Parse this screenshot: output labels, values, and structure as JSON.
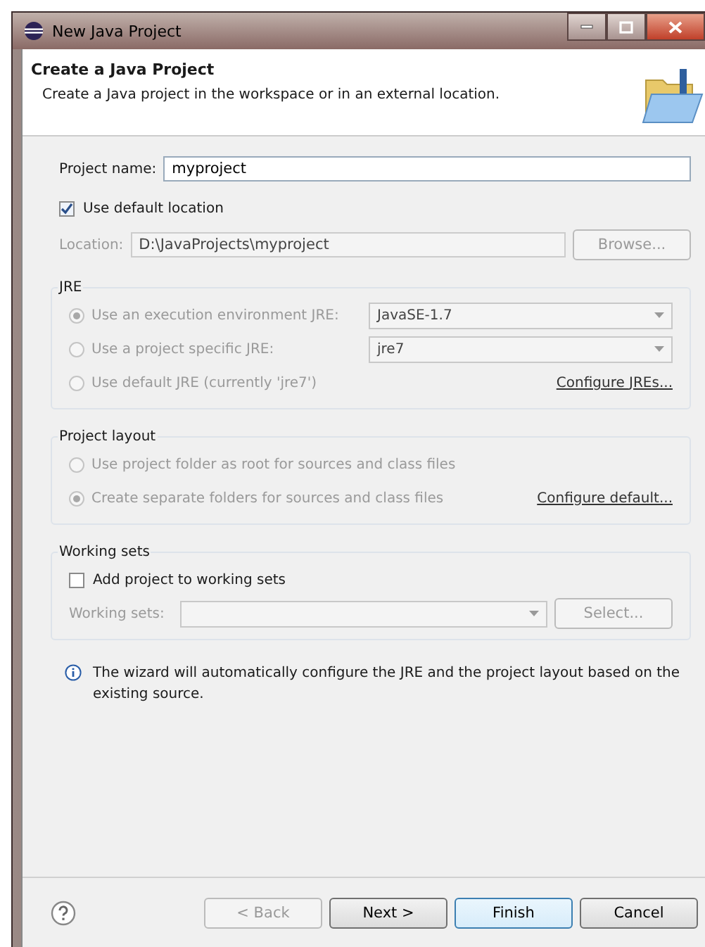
{
  "window": {
    "title": "New Java Project"
  },
  "header": {
    "title": "Create a Java Project",
    "description": "Create a Java project in the workspace or in an external location."
  },
  "project_name": {
    "label": "Project name:",
    "value": "myproject"
  },
  "use_default_location": {
    "label": "Use default location",
    "checked": true
  },
  "location": {
    "label": "Location:",
    "value": "D:\\JavaProjects\\myproject",
    "disabled": true,
    "button": "Browse..."
  },
  "jre": {
    "title": "JRE",
    "options": [
      {
        "kind": "combo",
        "label": "Use an execution environment JRE:",
        "selected": true,
        "disabled": true,
        "value": "JavaSE-1.7"
      },
      {
        "kind": "combo",
        "label": "Use a project specific JRE:",
        "selected": false,
        "disabled": true,
        "value": "jre7"
      },
      {
        "kind": "link",
        "label": "Use default JRE (currently 'jre7')",
        "selected": false,
        "disabled": true,
        "link": "Configure JREs..."
      }
    ]
  },
  "project_layout": {
    "title": "Project layout",
    "options": [
      {
        "kind": "plain",
        "label": "Use project folder as root for sources and class files",
        "selected": false,
        "disabled": true
      },
      {
        "kind": "link",
        "label": "Create separate folders for sources and class files",
        "selected": true,
        "disabled": true,
        "link": "Configure default..."
      }
    ]
  },
  "working_sets": {
    "title": "Working sets",
    "add": {
      "label": "Add project to working sets",
      "checked": false
    },
    "field_label": "Working sets:",
    "disabled": true,
    "button": "Select..."
  },
  "info": "The wizard will automatically configure the JRE and the project layout based on the existing source.",
  "buttons": [
    {
      "label": "< Back",
      "disabled": true,
      "default": false
    },
    {
      "label": "Next >",
      "disabled": false,
      "default": false
    },
    {
      "label": "Finish",
      "disabled": false,
      "default": true
    },
    {
      "label": "Cancel",
      "disabled": false,
      "default": false
    }
  ]
}
